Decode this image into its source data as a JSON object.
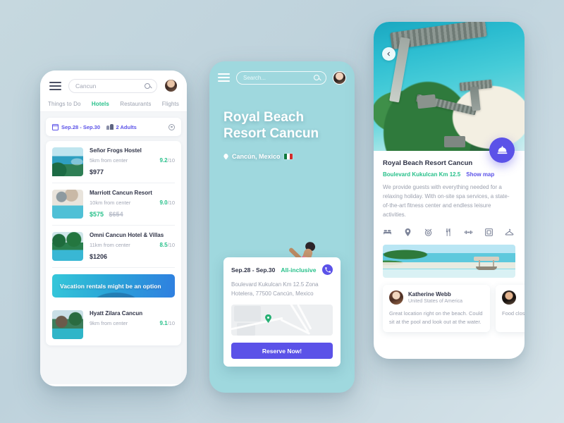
{
  "background_color": "#c3d6de",
  "accent": {
    "green": "#27c08a",
    "purple": "#5b52e8",
    "text_dark": "#2f3347",
    "text_muted": "#9ba0ae"
  },
  "left_phone": {
    "header": {
      "menu_icon": "hamburger-menu-icon",
      "search_value": "Cancun",
      "search_icon": "search-icon",
      "avatar": "user-avatar"
    },
    "tabs": [
      {
        "label": "Things to Do",
        "active": false
      },
      {
        "label": "Hotels",
        "active": true
      },
      {
        "label": "Restaurants",
        "active": false
      },
      {
        "label": "Flights",
        "active": false
      }
    ],
    "filter_bar": {
      "calendar_icon": "calendar-icon",
      "dates": "Sep.28 - Sep.30",
      "guests_icon": "people-icon",
      "guests": "2 Adults",
      "settings_icon": "gear-icon"
    },
    "hotels": [
      {
        "name": "Señor Frogs Hostel",
        "distance": "5km from center",
        "score": "9.2",
        "score_suffix": "/10",
        "price": "$977",
        "old_price": "",
        "thumb": "beach-pool-photo"
      },
      {
        "name": "Marriott Cancun Resort",
        "distance": "10km from center",
        "score": "9.0",
        "score_suffix": "/10",
        "price": "$575",
        "old_price": "$654",
        "thumb": "beach-resort-photo"
      },
      {
        "name": "Omni Cancun Hotel & Villas",
        "distance": "11km from center",
        "score": "8.5",
        "score_suffix": "/10",
        "price": "$1206",
        "old_price": "",
        "thumb": "palm-pool-photo"
      }
    ],
    "promo_banner": {
      "text": "Vacation rentals might be an option"
    },
    "hotels_after": [
      {
        "name": "Hyatt Zilara Cancun",
        "distance": "9km from center",
        "score": "9.1",
        "score_suffix": "/10",
        "thumb": "resort-mountain-photo"
      }
    ]
  },
  "center_phone": {
    "header": {
      "menu_icon": "hamburger-menu-icon",
      "search_placeholder": "Search...",
      "search_icon": "search-icon",
      "avatar": "user-avatar"
    },
    "title": "Royal Beach Resort Cancun",
    "location_icon": "location-pin-icon",
    "location": "Cancún, Mexico",
    "flag": "mexico-flag",
    "card": {
      "dates": "Sep.28 - Sep.30",
      "badge": "All-inclusive",
      "phone_icon": "phone-icon",
      "address": "Boulevard Kukulcan Km 12.5 Zona Hotelera, 77500 Cancún, Mexico",
      "map_pin": "map-marker-icon",
      "reserve_label": "Reserve Now!"
    }
  },
  "right_phone": {
    "back_icon": "chevron-left-icon",
    "fab_icon": "service-bell-icon",
    "title": "Royal Beach Resort Cancun",
    "address": "Boulevard Kukulcan Km 12.5",
    "show_map": "Show map",
    "description": "We provide guests with everything needed for a relaxing holiday. With on-site spa services, a state-of-the-art fitness center and endless leisure activities.",
    "amenities": [
      "bed-icon",
      "location-pin-icon",
      "alarm-clock-icon",
      "restaurant-icon",
      "dumbbell-icon",
      "television-icon",
      "laundry-hanger-icon"
    ],
    "gallery": "beach-boat-photo",
    "reviews": [
      {
        "name": "Katherine Webb",
        "country": "United States of America",
        "text": "Great location right on the beach. Could sit at the pool and look out at the water.",
        "avatar": "reviewer-avatar-female"
      },
      {
        "name": "",
        "country": "",
        "text": "Food close.",
        "avatar": "reviewer-avatar-male"
      }
    ]
  }
}
